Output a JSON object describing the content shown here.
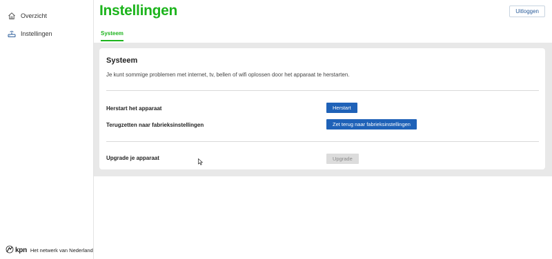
{
  "sidebar": {
    "items": [
      {
        "label": "Overzicht",
        "icon": "home-icon"
      },
      {
        "label": "Instellingen",
        "icon": "router-icon"
      }
    ],
    "brand_logo": "kpn",
    "brand_tagline": "Het netwerk van Nederland"
  },
  "header": {
    "title": "Instellingen",
    "logout_label": "Uitloggen",
    "active_tab": "Systeem"
  },
  "card": {
    "title": "Systeem",
    "description": "Je kunt sommige problemen met internet, tv, bellen of wifi oplossen door het apparaat te herstarten.",
    "rows": [
      {
        "label": "Herstart het apparaat",
        "button": "Herstart",
        "enabled": true
      },
      {
        "label": "Terugzetten naar fabrieksinstellingen",
        "button": "Zet terug naar fabrieksinstellingen",
        "enabled": true
      },
      {
        "label": "Upgrade je apparaat",
        "button": "Upgrade",
        "enabled": false
      }
    ]
  },
  "colors": {
    "brand_green": "#1db41d",
    "primary_button": "#1f62b8",
    "disabled_button": "#dcdcdc",
    "content_background": "#e8e8e8"
  }
}
